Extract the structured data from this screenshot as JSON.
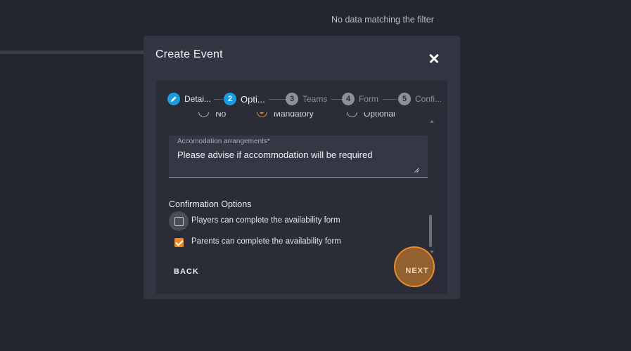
{
  "background": {
    "empty_message": "No data matching the filter"
  },
  "modal": {
    "title": "Create Event",
    "close_icon": "close-icon"
  },
  "stepper": {
    "steps": [
      {
        "number": "",
        "label": "Detai...",
        "state": "done",
        "icon": "pencil-icon"
      },
      {
        "number": "2",
        "label": "Opti...",
        "state": "active"
      },
      {
        "number": "3",
        "label": "Teams",
        "state": "pending"
      },
      {
        "number": "4",
        "label": "Form",
        "state": "pending"
      },
      {
        "number": "5",
        "label": "Confi...",
        "state": "pending"
      }
    ]
  },
  "radio_group": {
    "options": [
      {
        "label": "No",
        "selected": false
      },
      {
        "label": "Mandatory",
        "selected": true
      },
      {
        "label": "Optional",
        "selected": false
      }
    ]
  },
  "accommodation": {
    "label": "Accomodation arrangements*",
    "value": "Please advise if accommodation will be required"
  },
  "confirmation": {
    "title": "Confirmation Options",
    "options": [
      {
        "label": "Players can complete the availability form",
        "checked": false
      },
      {
        "label": "Parents can complete the availability form",
        "checked": true
      }
    ]
  },
  "actions": {
    "back_label": "BACK",
    "next_label": "NEXT"
  },
  "colors": {
    "accent": "#e98a2a",
    "step_active": "#1a9de0",
    "modal_bg": "#323643",
    "page_bg": "#24262f"
  }
}
